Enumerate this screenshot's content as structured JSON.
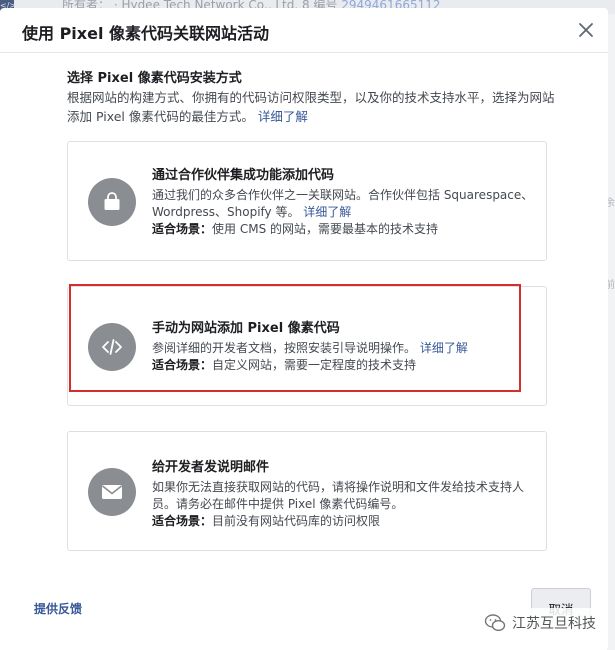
{
  "background": {
    "top_text": "所有者：  ·  Hydee Tech Network Co., Ltd. 8  编号",
    "top_link": "2949461665112",
    "left_icon": "</>",
    "right_glyphs": [
      "余",
      "前"
    ]
  },
  "dialog": {
    "title": "使用 Pixel 像素代码关联网站活动",
    "close_icon": "close-icon"
  },
  "section": {
    "title": "选择 Pixel 像素代码安装方式",
    "desc": "根据网站的构建方式、你拥有的代码访问权限类型，以及你的技术支持水平，选择为网站添加 Pixel 像素代码的最佳方式。",
    "link": "详细了解"
  },
  "scene_label": "适合场景：",
  "cards": [
    {
      "icon": "shopping-bag-icon",
      "title": "通过合作伙伴集成功能添加代码",
      "desc": "通过我们的众多合作伙伴之一关联网站。合作伙伴包括 Squarespace、Wordpress、Shopify 等。",
      "link": "详细了解",
      "scene": "使用 CMS 的网站，需要最基本的技术支持"
    },
    {
      "icon": "code-icon",
      "title": "手动为网站添加 Pixel 像素代码",
      "desc": "参阅详细的开发者文档，按照安装引导说明操作。",
      "link": "详细了解",
      "scene": "自定义网站，需要一定程度的技术支持"
    },
    {
      "icon": "envelope-icon",
      "title": "给开发者发说明邮件",
      "desc": "如果你无法直接获取网站的代码，请将操作说明和文件发给技术支持人员。请务必在邮件中提供 Pixel 像素代码编号。",
      "link": "",
      "scene": "目前没有网站代码库的访问权限"
    }
  ],
  "footer": {
    "feedback": "提供反馈",
    "cancel": "取消"
  },
  "watermark": {
    "text": "江苏互旦科技",
    "icon": "wechat-icon"
  },
  "colors": {
    "link": "#385898",
    "highlight": "#d32f2f",
    "icon_circle": "#8a8d91"
  }
}
